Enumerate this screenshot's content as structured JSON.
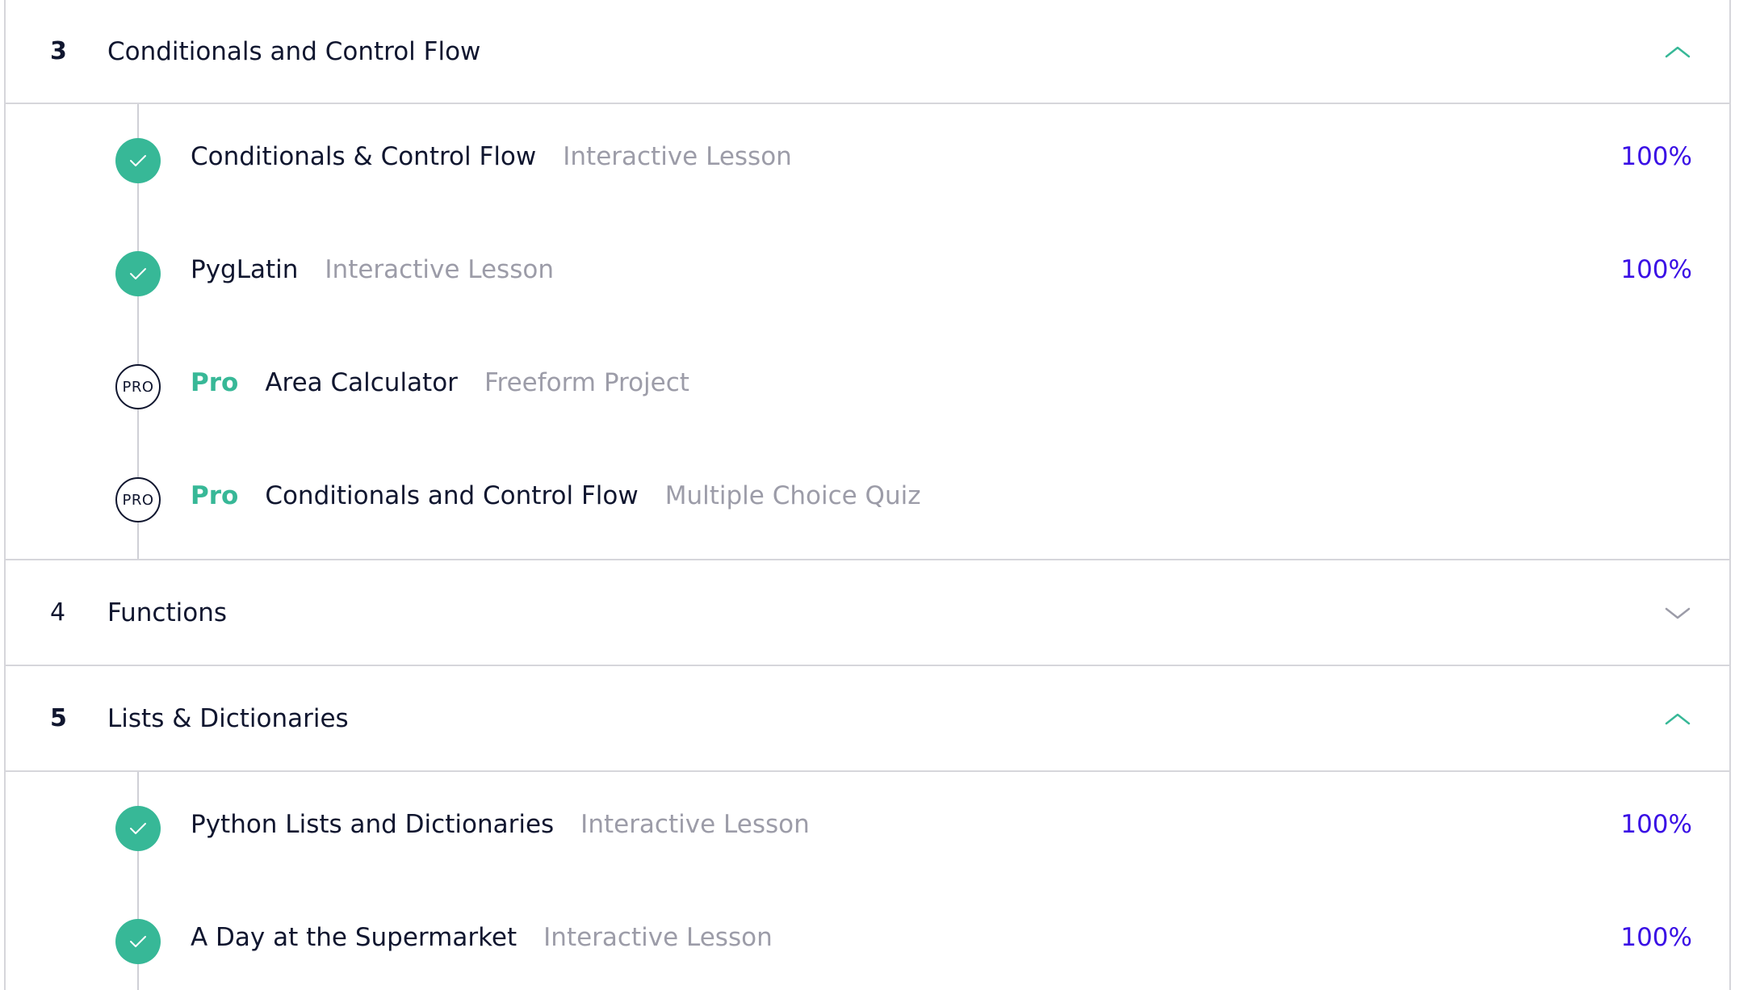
{
  "colors": {
    "accent_green": "#37b897",
    "progress_blue": "#3a10e5",
    "text_dark": "#10162f",
    "text_muted": "#9c9ca8",
    "divider": "#d6d6db"
  },
  "modules": [
    {
      "number": "3",
      "title": "Conditionals and Control Flow",
      "expanded": true,
      "chevron_icon": "chevron-up-icon",
      "lessons": [
        {
          "name": "Conditionals & Control Flow",
          "type": "Interactive Lesson",
          "status": "complete",
          "progress": "100%"
        },
        {
          "name": "PygLatin",
          "type": "Interactive Lesson",
          "status": "complete",
          "progress": "100%"
        },
        {
          "pro_badge": "PRO",
          "pro_label": "Pro",
          "name": "Area Calculator",
          "type": "Freeform Project",
          "status": "pro"
        },
        {
          "pro_badge": "PRO",
          "pro_label": "Pro",
          "name": "Conditionals and Control Flow",
          "type": "Multiple Choice Quiz",
          "status": "pro"
        }
      ]
    },
    {
      "number": "4",
      "title": "Functions",
      "expanded": false,
      "chevron_icon": "chevron-down-icon"
    },
    {
      "number": "5",
      "title": "Lists & Dictionaries",
      "expanded": true,
      "chevron_icon": "chevron-up-icon",
      "lessons": [
        {
          "name": "Python Lists and Dictionaries",
          "type": "Interactive Lesson",
          "status": "complete",
          "progress": "100%"
        },
        {
          "name": "A Day at the Supermarket",
          "type": "Interactive Lesson",
          "status": "complete",
          "progress": "100%"
        }
      ]
    }
  ]
}
